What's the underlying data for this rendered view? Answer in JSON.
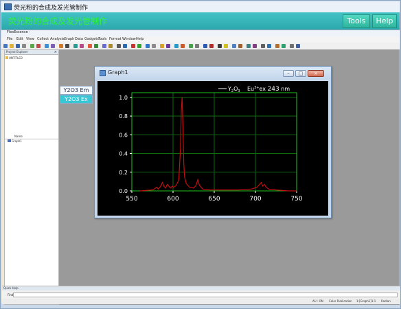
{
  "outer_window": {
    "title": "荧光粉的合成及发光管制作"
  },
  "banner": {
    "title": "荧光粉的合成及发光管制作",
    "tools_label": "Tools",
    "help_label": "Help"
  },
  "app": {
    "title": "FlexEssence -",
    "menu": [
      "File",
      "Edit",
      "View",
      "Collect",
      "Analysis",
      "Graph",
      "Data",
      "Gadgets",
      "Tools",
      "Format",
      "Window",
      "Help"
    ]
  },
  "explorer": {
    "title": "Project Explorer",
    "root": "UNTITLED",
    "list_header": "Name",
    "items": [
      "Graph1"
    ]
  },
  "side_buttons": {
    "em_label": "Y2O3 Em",
    "ex_label": "Y2O3 Ex"
  },
  "graph_window": {
    "title": "Graph1"
  },
  "chart_data": {
    "type": "line",
    "title": "",
    "xlabel": "",
    "ylabel": "",
    "xlim": [
      550,
      750
    ],
    "ylim": [
      0,
      1.05
    ],
    "xticks": [
      550,
      600,
      650,
      700,
      750
    ],
    "yticks": [
      0.0,
      0.2,
      0.4,
      0.6,
      0.8,
      1.0
    ],
    "xtick_labels": [
      "550",
      "600",
      "650",
      "700",
      "750"
    ],
    "ytick_labels": [
      "0.0",
      "0.2",
      "0.4",
      "0.6",
      "0.8",
      "1.0"
    ],
    "grid": true,
    "colors": {
      "background": "#000000",
      "grid": "#0f6a0f",
      "frame": "#1fc41f",
      "line": "#c01010",
      "text": "#ffffff"
    },
    "legend": {
      "placement": "top-right",
      "series_text": "Y2O3",
      "annotation": "Eu3+ ex 243 nm"
    },
    "series": [
      {
        "name": "Y2O3",
        "x": [
          560,
          575,
          578,
          580,
          582,
          585,
          587,
          589,
          591,
          593,
          595,
          597,
          599,
          601,
          604,
          607,
          609,
          610,
          611,
          612,
          613,
          614,
          616,
          620,
          625,
          628,
          630,
          632,
          636,
          645,
          660,
          680,
          695,
          702,
          705,
          707,
          709,
          711,
          713,
          716,
          725,
          740,
          750
        ],
        "y": [
          0.0,
          0.01,
          0.025,
          0.04,
          0.02,
          0.05,
          0.09,
          0.05,
          0.03,
          0.07,
          0.05,
          0.03,
          0.05,
          0.04,
          0.06,
          0.12,
          0.45,
          0.85,
          1.0,
          0.7,
          0.3,
          0.15,
          0.08,
          0.04,
          0.03,
          0.06,
          0.12,
          0.06,
          0.02,
          0.01,
          0.01,
          0.01,
          0.02,
          0.04,
          0.07,
          0.09,
          0.05,
          0.07,
          0.04,
          0.02,
          0.01,
          0.0,
          0.0
        ]
      }
    ]
  },
  "quick_help": {
    "title": "Quick Help",
    "find_label": "Find:",
    "find_value": ""
  },
  "status": {
    "items": [
      "AU : ON",
      "Color Publication",
      "1:[Graph1]1:1",
      "Radian"
    ]
  }
}
